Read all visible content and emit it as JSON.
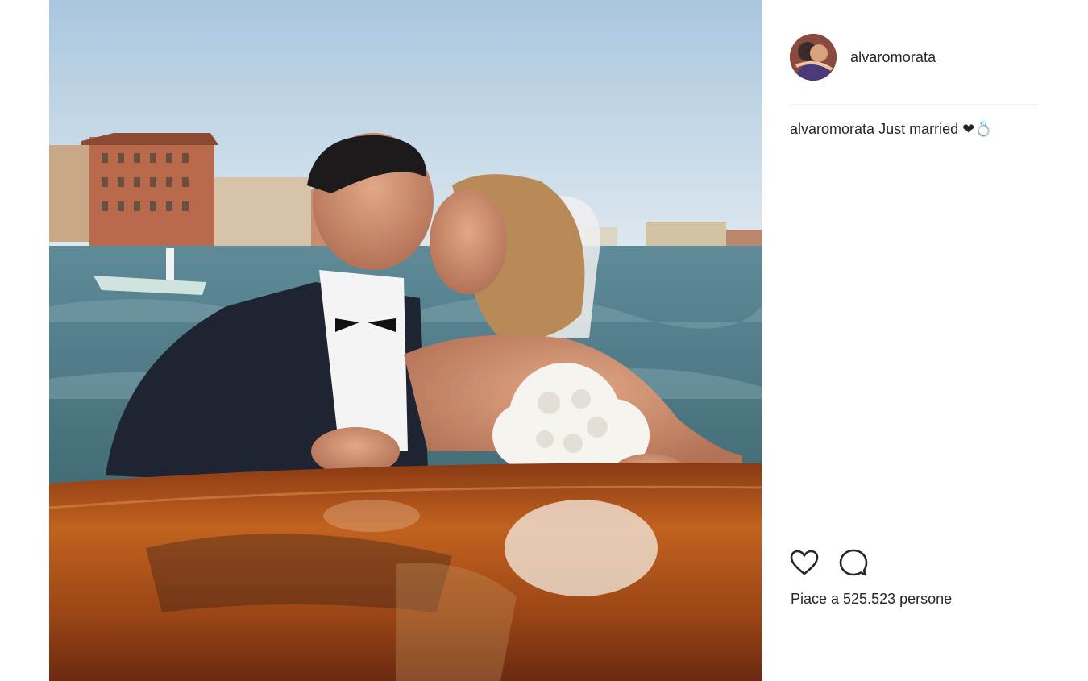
{
  "post": {
    "photo_description_icon": "wedding-photo-image",
    "username": "alvaromorata",
    "caption": {
      "username": "alvaromorata",
      "text": "Just married ❤💍"
    },
    "likes_text": "Piace a 525.523 persone"
  },
  "icons": {
    "like": "heart-outline-icon",
    "comment": "comment-bubble-icon"
  },
  "colors": {
    "text": "#262626",
    "divider": "#efefef",
    "background": "#ffffff"
  }
}
